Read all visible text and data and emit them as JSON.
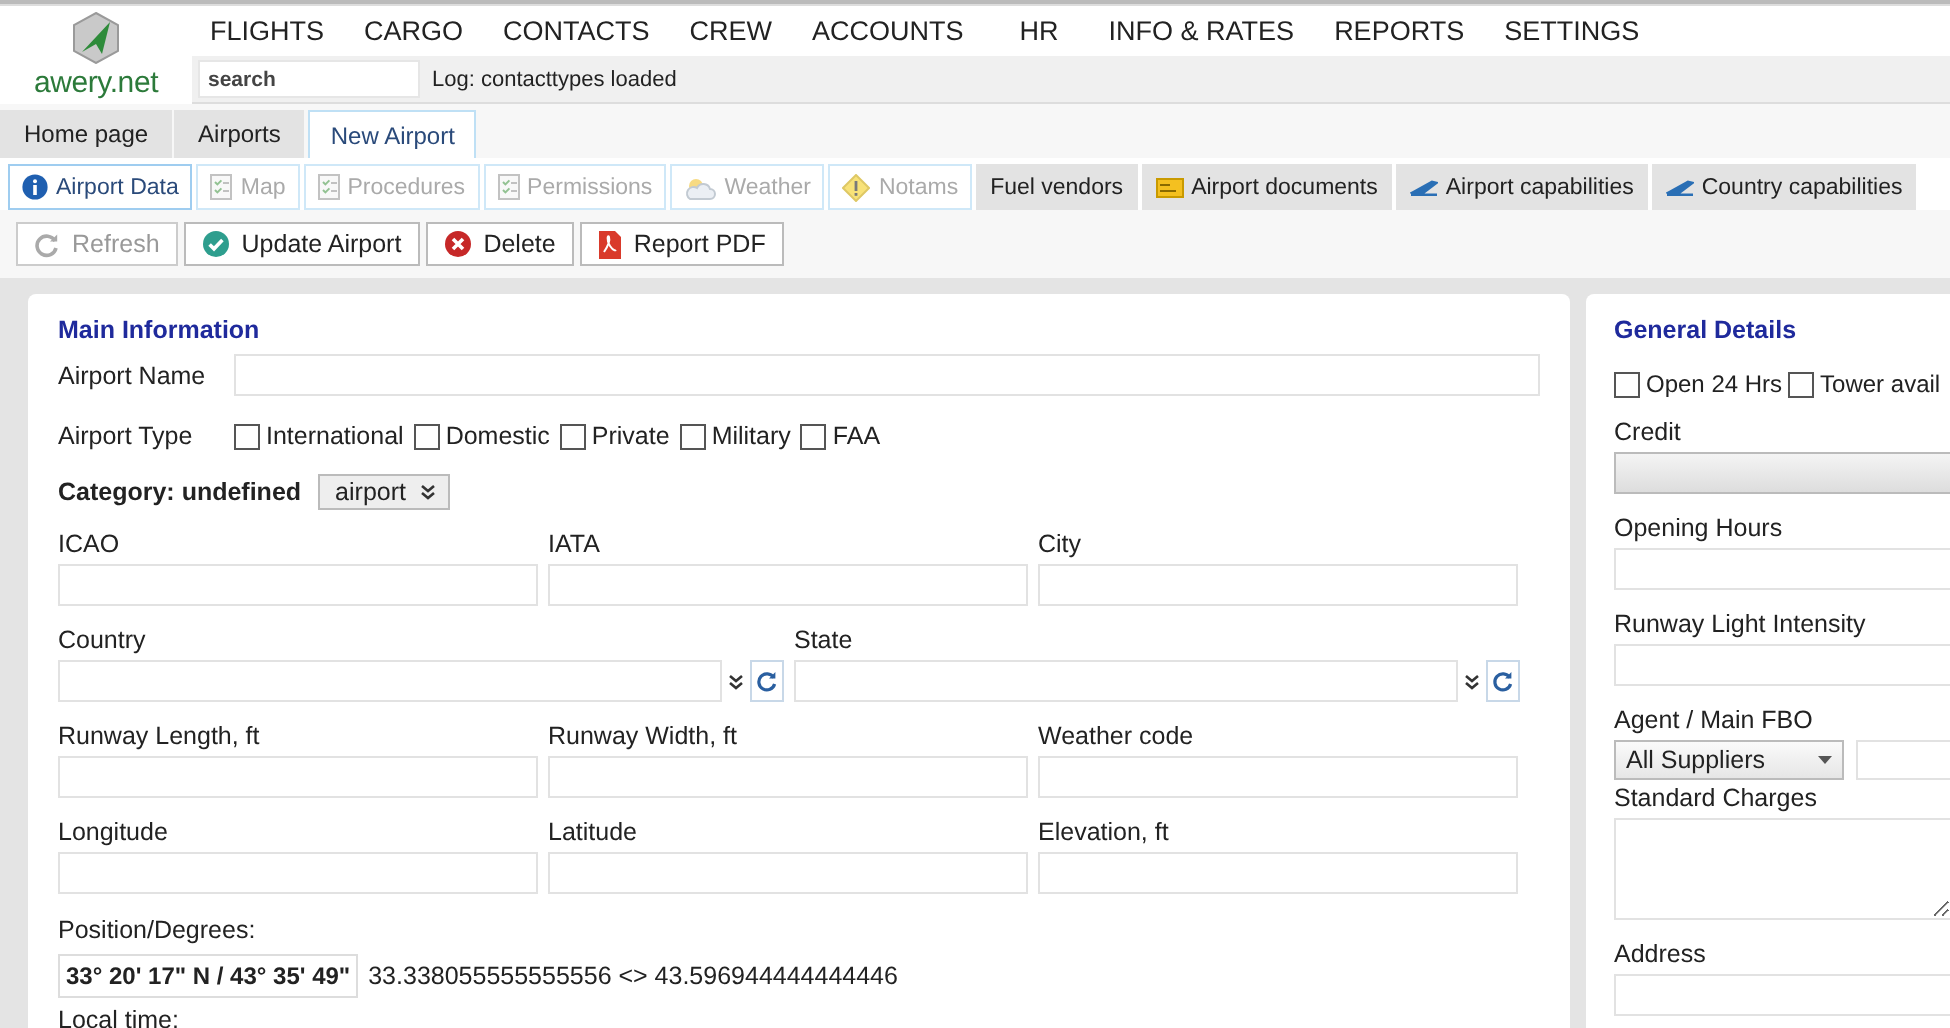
{
  "header": {
    "logo": "awery.net",
    "nav": [
      "FLIGHTS",
      "CARGO",
      "CONTACTS",
      "CREW",
      "ACCOUNTS",
      "HR",
      "INFO & RATES",
      "REPORTS",
      "SETTINGS"
    ],
    "search": {
      "placeholder": "search"
    },
    "log": "Log: contacttypes loaded"
  },
  "page_tabs": [
    {
      "label": "Home page",
      "selected": false
    },
    {
      "label": "Airports",
      "selected": false
    },
    {
      "label": "New Airport",
      "selected": true
    }
  ],
  "sub_tabs": [
    {
      "label": "Airport Data",
      "kind": "info",
      "selected": true,
      "disabled": false
    },
    {
      "label": "Map",
      "kind": "checklist",
      "selected": false,
      "disabled": true
    },
    {
      "label": "Procedures",
      "kind": "checklist",
      "selected": false,
      "disabled": true
    },
    {
      "label": "Permissions",
      "kind": "checklist",
      "selected": false,
      "disabled": true
    },
    {
      "label": "Weather",
      "kind": "weather",
      "selected": false,
      "disabled": true
    },
    {
      "label": "Notams",
      "kind": "warning",
      "selected": false,
      "disabled": true
    },
    {
      "label": "Fuel vendors",
      "kind": "plain",
      "selected": false,
      "disabled": false
    },
    {
      "label": "Airport documents",
      "kind": "card",
      "selected": false,
      "disabled": false
    },
    {
      "label": "Airport capabilities",
      "kind": "plane",
      "selected": false,
      "disabled": false
    },
    {
      "label": "Country capabilities",
      "kind": "plane",
      "selected": false,
      "disabled": false
    }
  ],
  "toolbar": [
    {
      "label": "Refresh",
      "kind": "refresh",
      "disabled": true
    },
    {
      "label": "Update Airport",
      "kind": "check",
      "disabled": false
    },
    {
      "label": "Delete",
      "kind": "delete",
      "disabled": false
    },
    {
      "label": "Report PDF",
      "kind": "pdf",
      "disabled": false
    }
  ],
  "main_information": {
    "title": "Main Information",
    "airport_name": {
      "label": "Airport Name"
    },
    "airport_type": {
      "label": "Airport Type",
      "options": [
        {
          "label": "International",
          "checked": false
        },
        {
          "label": "Domestic",
          "checked": false
        },
        {
          "label": "Private",
          "checked": false
        },
        {
          "label": "Military",
          "checked": false
        },
        {
          "label": "FAA",
          "checked": false
        }
      ]
    },
    "category": {
      "label": "Category: undefined",
      "select": "airport"
    },
    "rows": [
      [
        {
          "label": "ICAO",
          "kind": "text"
        },
        {
          "label": "IATA",
          "kind": "text"
        },
        {
          "label": "City",
          "kind": "text"
        }
      ],
      [
        {
          "label": "Country",
          "kind": "combo"
        },
        {
          "label": "State",
          "kind": "combo"
        }
      ],
      [
        {
          "label": "Runway Length, ft",
          "kind": "text"
        },
        {
          "label": "Runway Width, ft",
          "kind": "text"
        },
        {
          "label": "Weather code",
          "kind": "text"
        }
      ],
      [
        {
          "label": "Longitude",
          "kind": "text"
        },
        {
          "label": "Latitude",
          "kind": "text"
        },
        {
          "label": "Elevation, ft",
          "kind": "text"
        }
      ]
    ],
    "position": {
      "label": "Position/Degrees:",
      "value": "33° 20' 17\" N / 43° 35' 49\"",
      "decimal": "33.338055555555556 <> 43.596944444444446"
    },
    "local_time": {
      "label": "Local time:"
    }
  },
  "general_details": {
    "title": "General Details",
    "checks": [
      {
        "label": "Open 24 Hrs",
        "checked": false
      },
      {
        "label": "Tower avail",
        "checked": false
      }
    ],
    "fields": [
      {
        "label": "Credit",
        "kind": "bar"
      },
      {
        "label": "Opening Hours",
        "kind": "text"
      },
      {
        "label": "Runway Light Intensity",
        "kind": "text"
      },
      {
        "label": "Agent / Main FBO",
        "kind": "select",
        "value": "All Suppliers"
      },
      {
        "label": "Standard Charges",
        "kind": "textarea"
      },
      {
        "label": "Address",
        "kind": "text"
      }
    ]
  }
}
